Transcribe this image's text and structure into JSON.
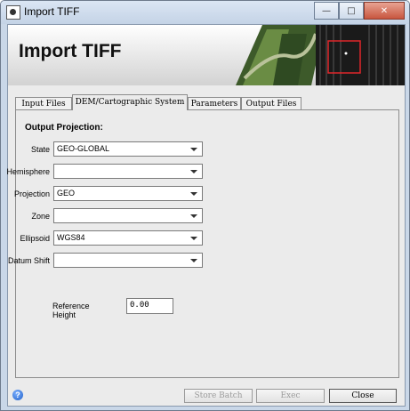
{
  "window": {
    "title": "Import TIFF"
  },
  "banner": {
    "title": "Import TIFF"
  },
  "tabs": [
    {
      "label": "Input Files"
    },
    {
      "label": "DEM/Cartographic System"
    },
    {
      "label": "Parameters"
    },
    {
      "label": "Output Files"
    }
  ],
  "active_tab": "DEM/Cartographic System",
  "section": {
    "title": "Output Projection:"
  },
  "fields": {
    "state": {
      "label": "State",
      "value": "GEO-GLOBAL"
    },
    "hemisphere": {
      "label": "Hemisphere",
      "value": ""
    },
    "projection": {
      "label": "Projection",
      "value": "GEO"
    },
    "zone": {
      "label": "Zone",
      "value": ""
    },
    "ellipsoid": {
      "label": "Ellipsoid",
      "value": "WGS84"
    },
    "datum_shift": {
      "label": "Datum Shift",
      "value": ""
    },
    "reference_height": {
      "label": "Reference Height",
      "value": "0.00"
    }
  },
  "buttons": {
    "store_batch": "Store Batch",
    "exec": "Exec",
    "close": "Close"
  },
  "help_icon": "question-icon",
  "colors": {
    "accent": "#e0262a"
  }
}
